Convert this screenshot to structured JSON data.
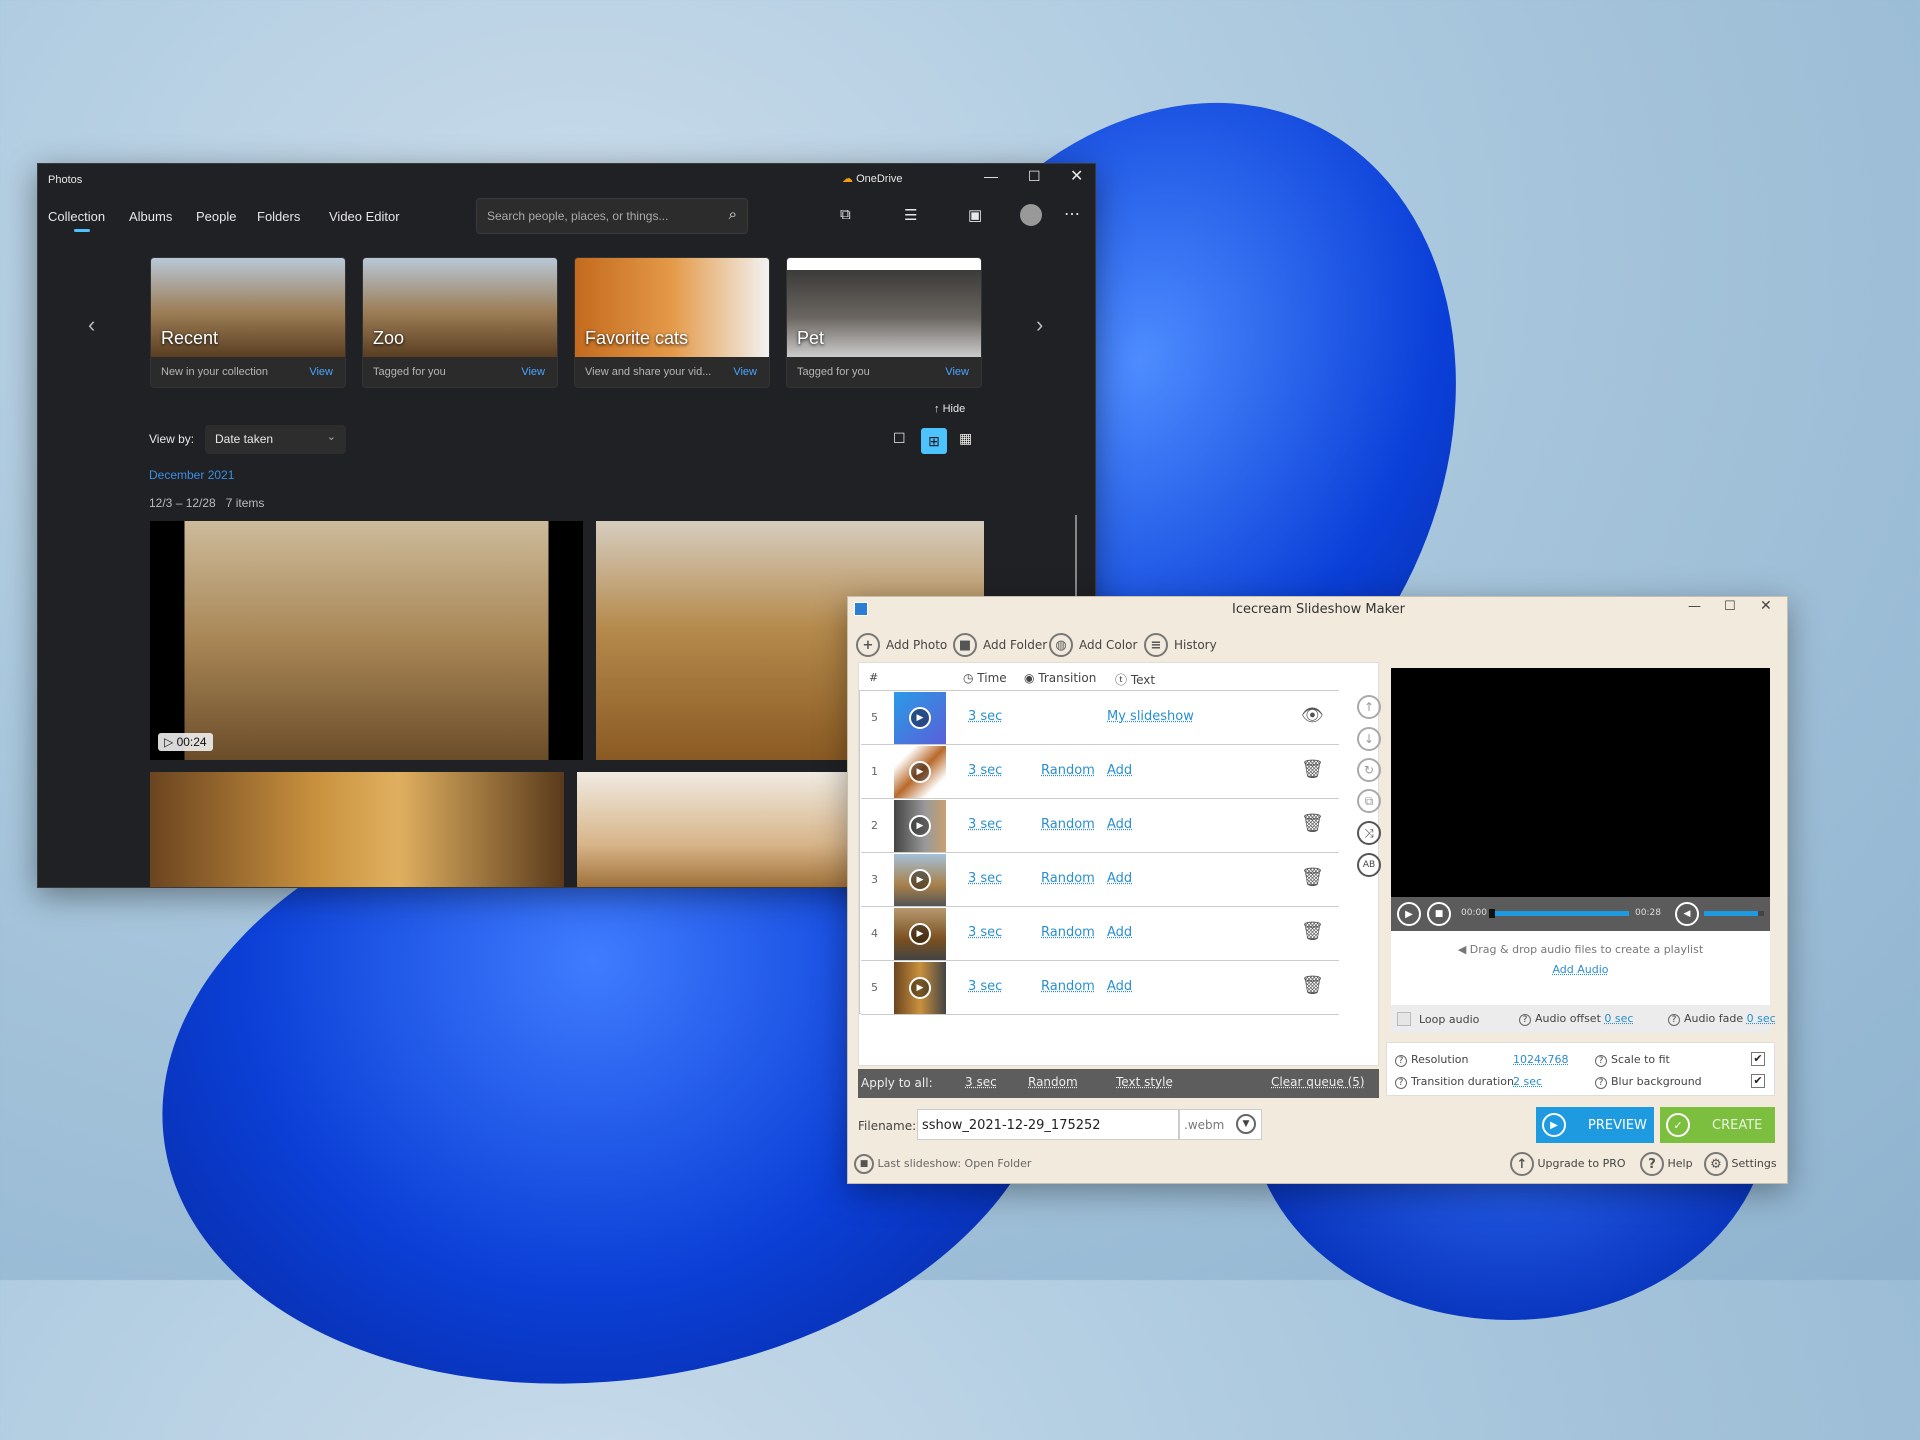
{
  "photos": {
    "title": "Photos",
    "onedrive": "OneDrive",
    "tabs": [
      "Collection",
      "Albums",
      "People",
      "Folders",
      "Video Editor"
    ],
    "search_placeholder": "Search people, places, or things...",
    "albums": [
      {
        "name": "Recent",
        "sub": "New in your collection",
        "view": "View"
      },
      {
        "name": "Zoo",
        "sub": "Tagged for you",
        "view": "View"
      },
      {
        "name": "Favorite cats",
        "sub": "View and share your vid...",
        "view": "View"
      },
      {
        "name": "Pet",
        "sub": "Tagged for you",
        "view": "View"
      }
    ],
    "hide": "Hide",
    "view_by": "View by:",
    "view_by_value": "Date taken",
    "month": "December 2021",
    "range": "12/3 – 12/28",
    "count": "7 items",
    "video_duration": "00:24"
  },
  "ice": {
    "title": "Icecream Slideshow Maker",
    "toolbar": [
      "Add Photo",
      "Add Folder",
      "Add Color",
      "History"
    ],
    "headers": {
      "num": "#",
      "time": "Time",
      "transition": "Transition",
      "text": "Text"
    },
    "rows": [
      {
        "num": "5",
        "time": "3 sec",
        "transition": "",
        "text": "My slideshow"
      },
      {
        "num": "1",
        "time": "3 sec",
        "transition": "Random",
        "text": "Add"
      },
      {
        "num": "2",
        "time": "3 sec",
        "transition": "Random",
        "text": "Add"
      },
      {
        "num": "3",
        "time": "3 sec",
        "transition": "Random",
        "text": "Add"
      },
      {
        "num": "4",
        "time": "3 sec",
        "transition": "Random",
        "text": "Add"
      },
      {
        "num": "5",
        "time": "3 sec",
        "transition": "Random",
        "text": "Add"
      }
    ],
    "apply": {
      "label": "Apply to all:",
      "time": "3 sec",
      "transition": "Random",
      "text": "Text style",
      "clear": "Clear queue (5)"
    },
    "filename_label": "Filename:",
    "filename": "sshow_2021-12-29_175252",
    "ext": ".webm",
    "last": "Last slideshow: Open Folder",
    "player": {
      "current": "00:00",
      "total": "00:28",
      "progress": 0,
      "volume": 0.9
    },
    "audio": {
      "drop": "Drag & drop audio files to create a playlist",
      "add": "Add Audio",
      "loop": "Loop audio",
      "offset_label": "Audio offset",
      "offset": "0 sec",
      "fade_label": "Audio fade",
      "fade": "0 sec"
    },
    "settings": {
      "resolution_label": "Resolution",
      "resolution": "1024x768",
      "td_label": "Transition duration",
      "td": "2 sec",
      "scale": "Scale to fit",
      "blur": "Blur background",
      "scale_checked": true,
      "blur_checked": true
    },
    "preview": "PREVIEW",
    "create": "CREATE",
    "upgrade": "Upgrade to PRO",
    "help": "Help",
    "settings_btn": "Settings",
    "colors": {
      "preview": "#1e9be0",
      "create": "#7cbf3f"
    }
  }
}
